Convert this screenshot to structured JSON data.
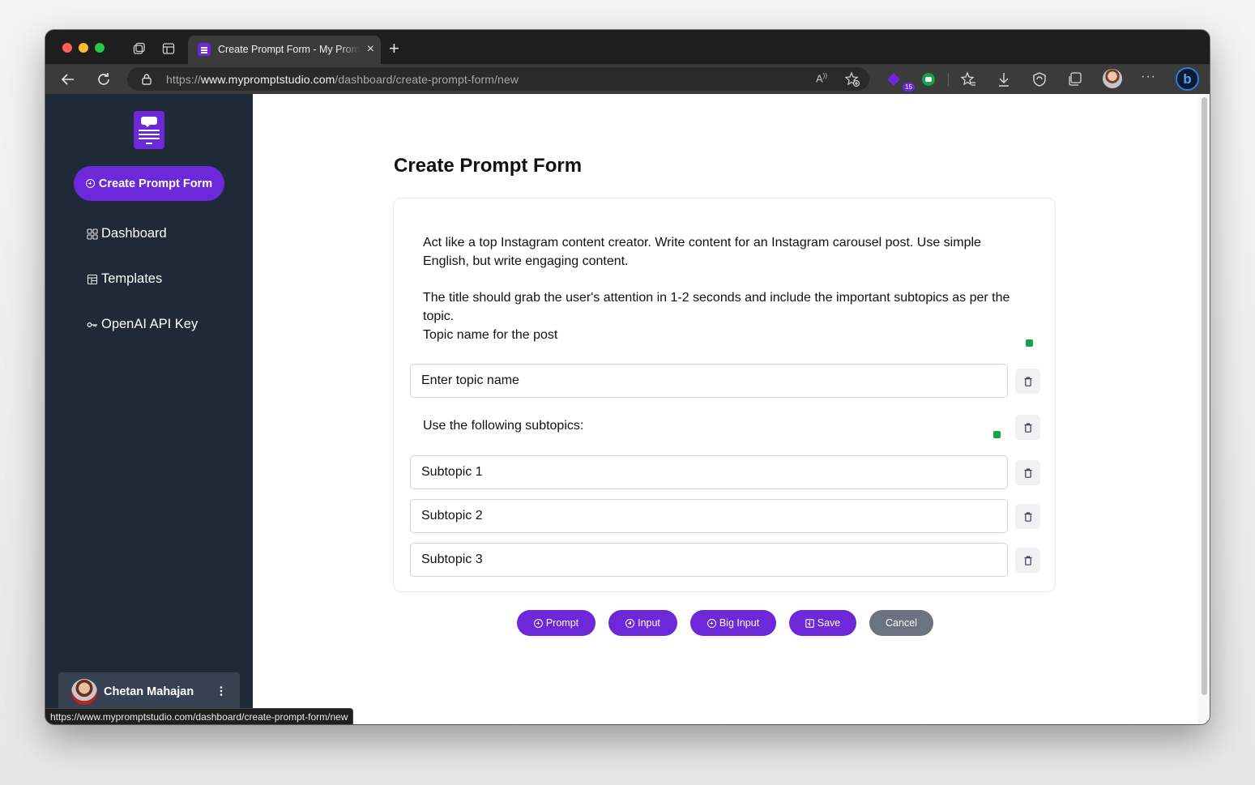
{
  "browser": {
    "tab_title": "Create Prompt Form - My Prompt Studio",
    "url_scheme": "https://",
    "url_host": "www.mypromptstudio.com",
    "url_path": "/dashboard/create-prompt-form/new",
    "extension_badge": "15",
    "status_url": "https://www.mypromptstudio.com/dashboard/create-prompt-form/new"
  },
  "sidebar": {
    "create_button": "Create Prompt Form",
    "items": [
      {
        "label": "Dashboard",
        "icon": "grid-icon"
      },
      {
        "label": "Templates",
        "icon": "template-icon"
      },
      {
        "label": "OpenAI API Key",
        "icon": "key-icon"
      }
    ],
    "user_name": "Chetan Mahajan"
  },
  "main": {
    "title": "Create Prompt Form",
    "prompt_paragraph_1": "Act like a top Instagram content creator. Write content for an Instagram carousel post. Use simple English, but write engaging content.",
    "prompt_paragraph_2": "The title should grab the user's attention in 1-2 seconds and include the important subtopics as per the topic.",
    "prompt_paragraph_3": "Topic name for the post",
    "topic_input": "Enter topic name",
    "subtopics_prompt": "Use the following subtopics:",
    "subtopic_inputs": [
      "Subtopic 1",
      "Subtopic 2",
      "Subtopic 3"
    ]
  },
  "actions": {
    "prompt": "Prompt",
    "input": "Input",
    "big_input": "Big Input",
    "save": "Save",
    "cancel": "Cancel"
  },
  "colors": {
    "accent": "#6d28d9",
    "sidebar_bg": "#1f2937",
    "cancel": "#6b7280",
    "indicator_green": "#16a34a"
  }
}
